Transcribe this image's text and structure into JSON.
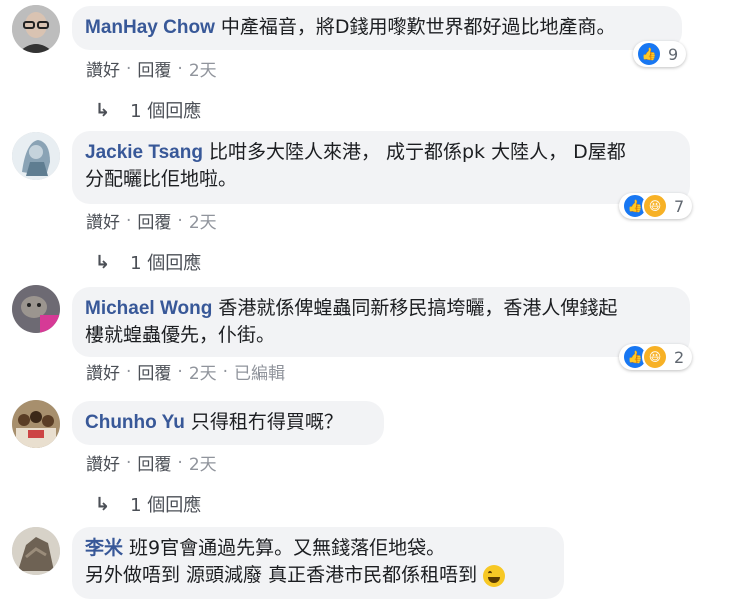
{
  "comments": [
    {
      "author": "ManHay Chow",
      "text": "中產福音，將D錢用嚟歎世界都好過比地產商。",
      "reaction_count": "9",
      "actions": {
        "like": "讚好",
        "reply": "回覆",
        "time": "2天"
      },
      "replies": "1 個回應",
      "avatar": "avatar-man-glasses"
    },
    {
      "author": "Jackie Tsang",
      "text_line1": "比咁多大陸人來港， 成亍都係pk 大陸人， D屋都",
      "text_line2": "分配曬比佢地啦。",
      "reaction_count": "7",
      "actions": {
        "like": "讚好",
        "reply": "回覆",
        "time": "2天"
      },
      "replies": "1 個回應",
      "avatar": "avatar-sketch"
    },
    {
      "author": "Michael Wong",
      "text_line1": "香港就係俾蝗蟲同新移民搞垮曬，香港人俾錢起",
      "text_line2": "樓就蝗蟲優先，仆街。",
      "reaction_count": "2",
      "actions": {
        "like": "讚好",
        "reply": "回覆",
        "time": "2天",
        "edited": "已編輯"
      },
      "avatar": "avatar-cat"
    },
    {
      "author": "Chunho Yu",
      "text": "只得租冇得買嘅？",
      "actions": {
        "like": "讚好",
        "reply": "回覆",
        "time": "2天"
      },
      "replies": "1 個回應",
      "avatar": "avatar-group-photo"
    },
    {
      "author": "李米",
      "text_line1": "班9官會通過先算。又無錢落佢地袋。",
      "text_line2": "另外做唔到 源頭減廢 真正香港市民都係租唔到",
      "avatar": "avatar-rock"
    }
  ],
  "colors": {
    "author": "#385898",
    "bubble": "#f2f3f5",
    "like": "#1877f2",
    "haha": "#f7b125"
  }
}
